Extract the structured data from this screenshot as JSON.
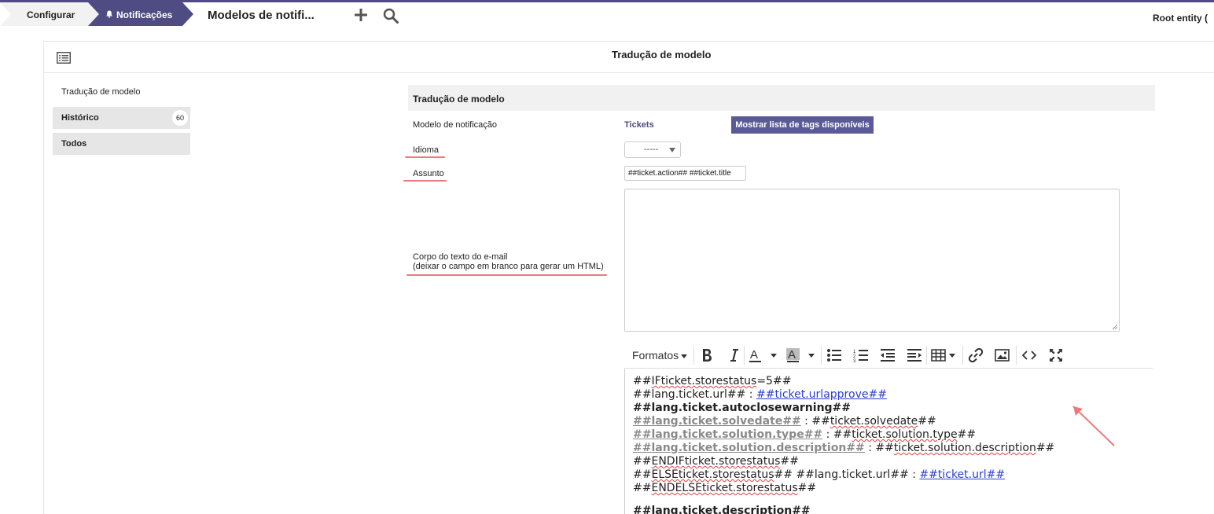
{
  "breadcrumb": {
    "configure": "Configurar",
    "notifications": "Notificações"
  },
  "header": {
    "title": "Modelos de notifi...",
    "entity": "Root entity ("
  },
  "card": {
    "title": "Tradução de modelo"
  },
  "tabs": [
    {
      "label": "Tradução de modelo"
    },
    {
      "label": "Histórico",
      "badge": "60"
    },
    {
      "label": "Todos"
    }
  ],
  "form": {
    "section_title": "Tradução de modelo",
    "template_label": "Modelo de notificação",
    "template_value": "Tickets",
    "tags_button": "Mostrar lista de tags disponíveis",
    "language_label": "Idioma",
    "language_value": "-----",
    "subject_label": "Assunto",
    "subject_value": "##ticket.action## ##ticket.title",
    "body_label_line1": "Corpo do texto do e-mail",
    "body_label_line2": "(deixar o campo em branco para gerar um HTML)"
  },
  "editor": {
    "formats": "Formatos",
    "lines": [
      [
        "##",
        "IFticket.storestatus",
        "=5##"
      ],
      [
        "##lang.ticket.url## : ",
        "##ticket.urlapprove##"
      ],
      [
        "##lang.ticket.autoclosewarning##"
      ],
      [
        "##lang.ticket.solvedate##",
        " : ##",
        "ticket.solvedate",
        "##"
      ],
      [
        "##lang.ticket.solution.type##",
        " : ##",
        "ticket.solution.type",
        "##"
      ],
      [
        "##lang.ticket.solution.description##",
        " : ##",
        "ticket.solution.description",
        "##"
      ],
      [
        "##",
        "ENDIFticket.storestatus",
        "##"
      ],
      [
        "##",
        "ELSEticket.storestatus",
        "## ##lang.ticket.url## : ",
        "##ticket.url##"
      ],
      [
        "##",
        "ENDELSEticket.storestatus",
        "##"
      ],
      [
        "##lang.ticket.description##"
      ]
    ]
  },
  "colors": {
    "brand": "#4e4c82",
    "button": "#5b5a99",
    "annotation": "#e97b7b"
  }
}
